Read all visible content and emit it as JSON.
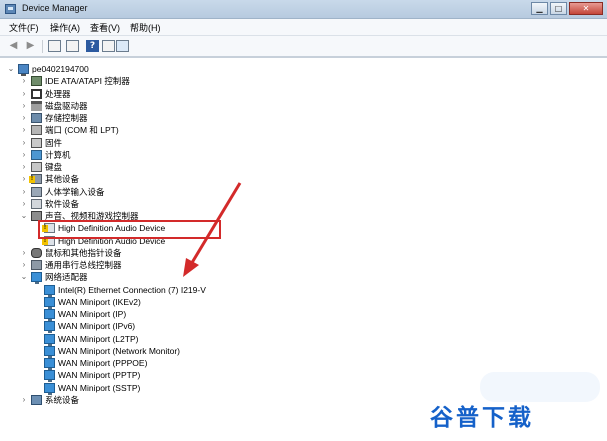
{
  "window": {
    "title": "Device Manager",
    "controls": [
      "▁",
      "□",
      "✕"
    ]
  },
  "menu": [
    "文件(F)",
    "操作(A)",
    "查看(V)",
    "帮助(H)"
  ],
  "toolbar": {
    "help": "?"
  },
  "tree": {
    "root": "pe0402194700",
    "items": [
      {
        "label": "IDE ATA/ATAPI 控制器",
        "icon": "ide-controller-icon",
        "cls": "ide"
      },
      {
        "label": "处理器",
        "icon": "processor-icon",
        "cls": "cpu"
      },
      {
        "label": "磁盘驱动器",
        "icon": "disk-drive-icon",
        "cls": "disk"
      },
      {
        "label": "存储控制器",
        "icon": "storage-controller-icon",
        "cls": "storage"
      },
      {
        "label": "端口 (COM 和 LPT)",
        "icon": "port-icon",
        "cls": "port"
      },
      {
        "label": "固件",
        "icon": "firmware-icon",
        "cls": "firmware"
      },
      {
        "label": "计算机",
        "icon": "computer-icon",
        "cls": "monitor"
      },
      {
        "label": "键盘",
        "icon": "keyboard-icon",
        "cls": "keyboard"
      },
      {
        "label": "其他设备",
        "icon": "other-devices-icon",
        "cls": "generic warn"
      },
      {
        "label": "人体学输入设备",
        "icon": "hid-icon",
        "cls": "hid"
      },
      {
        "label": "软件设备",
        "icon": "software-device-icon",
        "cls": "sw"
      },
      {
        "label": "声音、视频和游戏控制器",
        "icon": "sound-controller-icon",
        "cls": "sound",
        "expanded": true,
        "children": [
          "High Definition Audio Device",
          "High Definition Audio Device"
        ]
      },
      {
        "label": "鼠标和其他指针设备",
        "icon": "mouse-icon",
        "cls": "mouse"
      },
      {
        "label": "通用串行总线控制器",
        "icon": "usb-controller-icon",
        "cls": "usb"
      },
      {
        "label": "网络适配器",
        "icon": "network-adapter-icon",
        "cls": "net",
        "expanded": true,
        "children": [
          "Intel(R) Ethernet Connection (7) I219-V",
          "WAN Miniport (IKEv2)",
          "WAN Miniport (IP)",
          "WAN Miniport (IPv6)",
          "WAN Miniport (L2TP)",
          "WAN Miniport (Network Monitor)",
          "WAN Miniport (PPPOE)",
          "WAN Miniport (PPTP)",
          "WAN Miniport (SSTP)"
        ]
      },
      {
        "label": "系统设备",
        "icon": "system-devices-icon",
        "cls": "sys"
      }
    ]
  },
  "watermark": "谷普下载",
  "colors": {
    "highlight": "#d32a2a",
    "watermark": "#1561c9",
    "titlebar": "#b7cadf"
  }
}
